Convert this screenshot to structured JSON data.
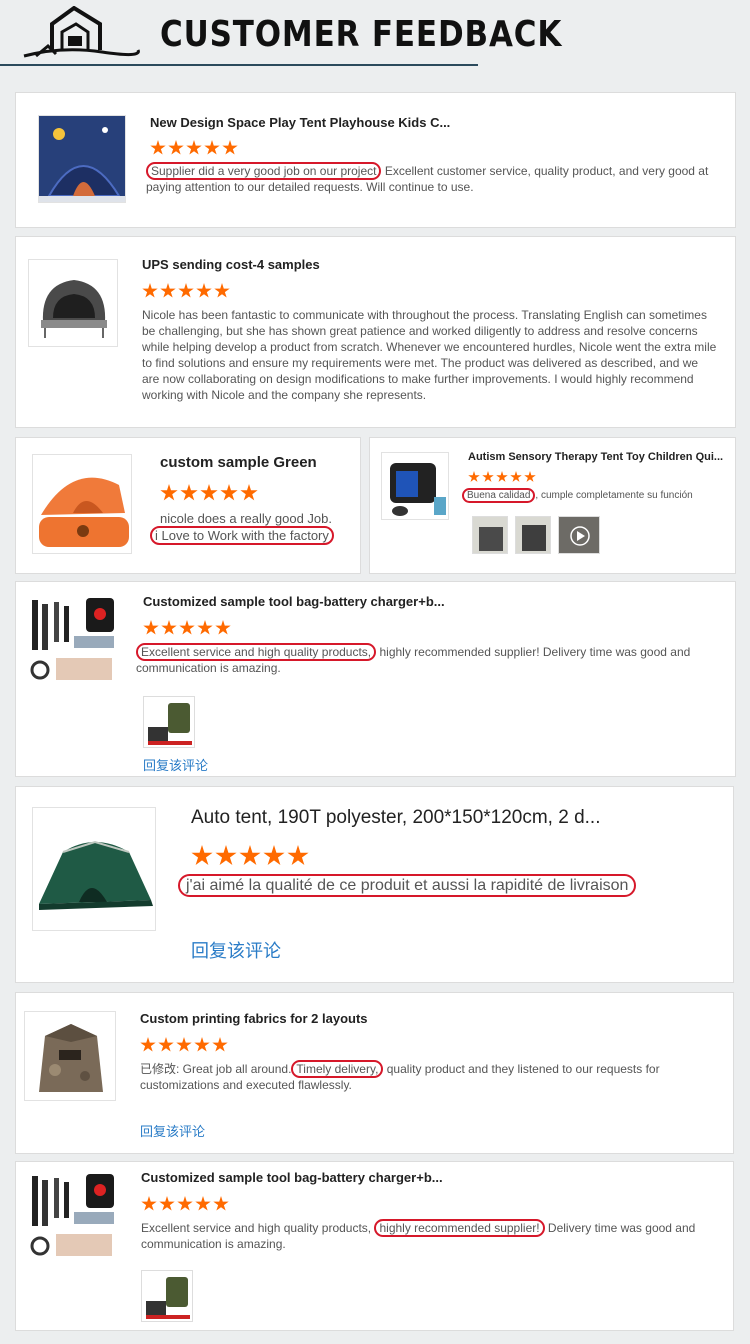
{
  "header": {
    "title": "CUSTOMER FEEDBACK",
    "logo_icon": "house-logo-icon"
  },
  "accent_star": "#ff6a00",
  "highlight_color": "#d6182a",
  "reply_color": "#2a7cc7",
  "reviews": [
    {
      "title": "New Design Space Play Tent Playhouse Kids C...",
      "hl": "Supplier did a very good job on our project",
      "rest": " Excellent customer service, quality product, and very good at paying attention to our detailed requests.  Will continue to use."
    },
    {
      "title": "UPS sending cost-4 samples",
      "text": "Nicole has been fantastic to communicate with throughout the process. Translating English can sometimes be challenging, but she has shown great patience and worked diligently to address and resolve concerns while helping develop a product from scratch. Whenever we encountered hurdles, Nicole went the extra mile to find solutions and ensure my requirements were met. The product was delivered as described, and we are now collaborating on design modifications to make further improvements. I would highly recommend working with Nicole and the company she represents."
    },
    {
      "title": "custom sample Green",
      "line1": "nicole does a really good Job.",
      "hl": "i Love to Work with the factory"
    },
    {
      "title": "Autism Sensory Therapy Tent Toy Children Qui...",
      "hl": "Buena calidad",
      "rest": ", cumple completamente su función"
    },
    {
      "title": "Customized sample tool bag-battery charger+b...",
      "hl": "Excellent service and high quality products,",
      "rest": " highly recommended supplier! Delivery time was good and communication is amazing.",
      "reply": "回复该评论"
    },
    {
      "title": "Auto tent, 190T polyester, 200*150*120cm, 2 d...",
      "hl": "j'ai aimé la qualité de ce produit et aussi la rapidité de livraison",
      "reply": "回复该评论"
    },
    {
      "title": "Custom printing fabrics for 2 layouts",
      "prefix": "已修改: Great job all around.",
      "hl": "Timely delivery,",
      "rest": " quality product and they listened to our requests for customizations and executed flawlessly.",
      "reply": "回复该评论"
    },
    {
      "title": "Customized sample tool bag-battery charger+b...",
      "prefix": "Excellent service and high quality products,",
      "hl": "highly recommended supplier!",
      "rest": " Delivery time was good and communication is amazing."
    }
  ]
}
